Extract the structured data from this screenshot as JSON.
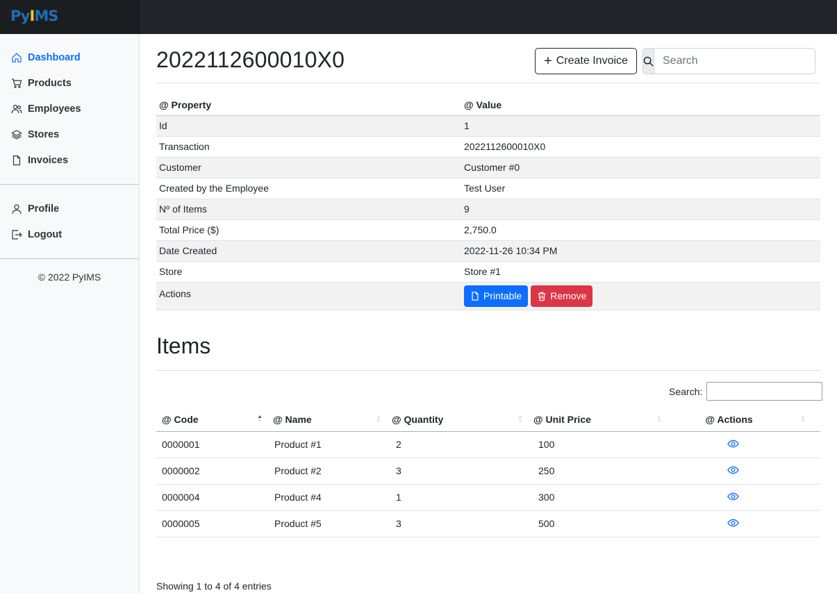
{
  "brand": {
    "part1": "Py",
    "part2": "I",
    "part3": "MS"
  },
  "sidebar": {
    "items": [
      {
        "label": "Dashboard",
        "icon": "home-icon",
        "active": true
      },
      {
        "label": "Products",
        "icon": "cart-icon"
      },
      {
        "label": "Employees",
        "icon": "people-icon"
      },
      {
        "label": "Stores",
        "icon": "layers-icon"
      },
      {
        "label": "Invoices",
        "icon": "file-icon"
      }
    ],
    "account": [
      {
        "label": "Profile",
        "icon": "person-icon"
      },
      {
        "label": "Logout",
        "icon": "logout-icon"
      }
    ],
    "copyright": "© 2022 PyIMS"
  },
  "header": {
    "title": "202211260001​0X0",
    "create_label": "Create Invoice",
    "search_placeholder": "Search"
  },
  "properties": {
    "col_property": "@ Property",
    "col_value": "@ Value",
    "rows": [
      {
        "property": "Id",
        "value": "1"
      },
      {
        "property": "Transaction",
        "value": "2022112600010X0"
      },
      {
        "property": "Customer",
        "value": "Customer #0"
      },
      {
        "property": "Created by the Employee",
        "value": "Test User"
      },
      {
        "property": "Nº of Items",
        "value": "9"
      },
      {
        "property": "Total Price ($)",
        "value": "2,750.0"
      },
      {
        "property": "Date Created",
        "value": "2022-11-26 10:34 PM"
      },
      {
        "property": "Store",
        "value": "Store #1"
      }
    ],
    "actions_label": "Actions",
    "printable_label": "Printable",
    "remove_label": "Remove"
  },
  "items": {
    "title": "Items",
    "search_label": "Search:",
    "columns": [
      "@ Code",
      "@ Name",
      "@ Quantity",
      "@ Unit Price",
      "@ Actions"
    ],
    "rows": [
      {
        "code": "0000001",
        "name": "Product #1",
        "quantity": "2",
        "unit_price": "100"
      },
      {
        "code": "0000002",
        "name": "Product #2",
        "quantity": "3",
        "unit_price": "250"
      },
      {
        "code": "0000004",
        "name": "Product #4",
        "quantity": "1",
        "unit_price": "300"
      },
      {
        "code": "0000005",
        "name": "Product #5",
        "quantity": "3",
        "unit_price": "500"
      }
    ],
    "info": "Showing 1 to 4 of 4 entries"
  }
}
